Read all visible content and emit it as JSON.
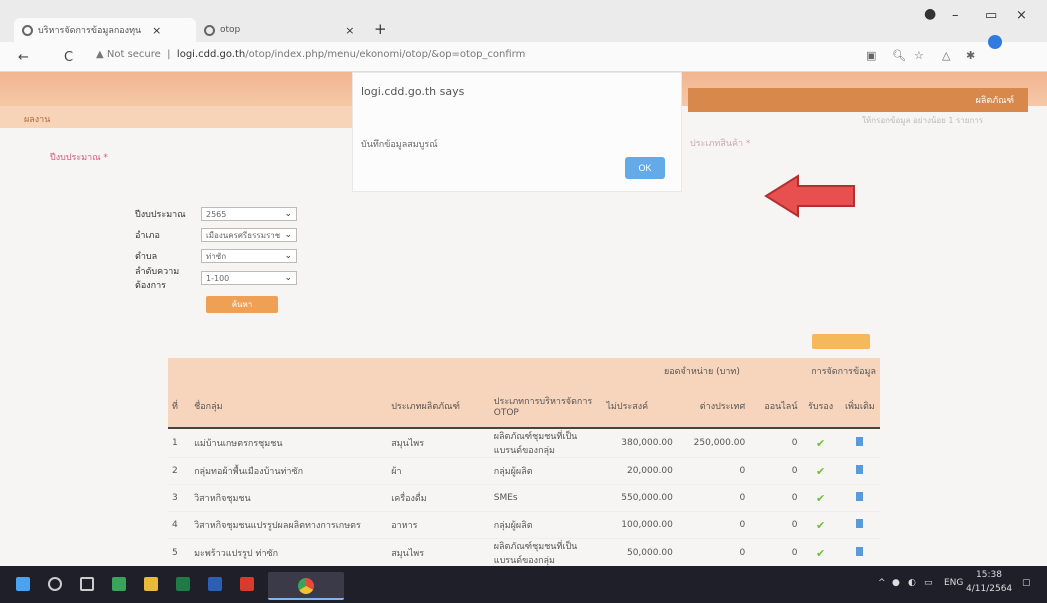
{
  "browser": {
    "tabs": [
      {
        "title": "บริหารจัดการข้อมูลกองทุน"
      },
      {
        "title": "otop"
      }
    ],
    "new_tab": "+",
    "url_prefix": "Not secure",
    "url_host": "logi.cdd.go.th",
    "url_path": "/otop/index.php/menu/ekonomi/otop/&op=otop_confirm",
    "window": {
      "minimize": "–",
      "maximize": "▭",
      "close": "×"
    }
  },
  "page": {
    "band_left": "ผลงาน",
    "band_right": "ผลิตภัณฑ์",
    "required_label": "ปีงบประมาณ *",
    "required_label_right": "ประเภทสินค้า *",
    "help_text": "ให้กรอกข้อมูล อย่างน้อย 1 รายการ"
  },
  "dialog": {
    "title": "logi.cdd.go.th says",
    "message": "บันทึกข้อมูลสมบูรณ์",
    "ok_label": "OK"
  },
  "filters": [
    {
      "label": "ปีงบประมาณ",
      "value": "2565"
    },
    {
      "label": "อำเภอ",
      "value": "เมืองนครศรีธรรมราช"
    },
    {
      "label": "ตำบล",
      "value": "ท่าซัก"
    },
    {
      "label": "ลำดับความต้องการ",
      "value": "1-100"
    }
  ],
  "search_label": "ค้นหา",
  "table": {
    "header_group_sales": "ยอดจำหน่าย (บาท)",
    "header_group_manage": "การจัดการข้อมูล",
    "columns": [
      "ที่",
      "ชื่อกลุ่ม",
      "ประเภทผลิตภัณฑ์",
      "ประเภทการบริหารจัดการ OTOP",
      "ไม่ประสงค์",
      "ต่างประเทศ",
      "ออนไลน์",
      "รับรอง",
      "เพิ่มเติม"
    ],
    "rows": [
      {
        "no": "1",
        "name": "แม่บ้านเกษตรกรชุมชน",
        "type": "สมุนไพร",
        "mgmt": "ผลิตภัณฑ์ชุมชนที่เป็นแบรนด์ของกลุ่ม",
        "sales": "380,000.00",
        "foreign": "250,000.00",
        "online": "0"
      },
      {
        "no": "2",
        "name": "กลุ่มทอผ้าพื้นเมืองบ้านท่าซัก",
        "type": "ผ้า",
        "mgmt": "กลุ่มผู้ผลิต",
        "sales": "20,000.00",
        "foreign": "0",
        "online": "0"
      },
      {
        "no": "3",
        "name": "วิสาหกิจชุมชน",
        "type": "เครื่องดื่ม",
        "mgmt": "SMEs",
        "sales": "550,000.00",
        "foreign": "0",
        "online": "0"
      },
      {
        "no": "4",
        "name": "วิสาหกิจชุมชนแปรรูปผลผลิตทางการเกษตร",
        "type": "อาหาร",
        "mgmt": "กลุ่มผู้ผลิต",
        "sales": "100,000.00",
        "foreign": "0",
        "online": "0"
      },
      {
        "no": "5",
        "name": "มะพร้าวแปรรูป ท่าซัก",
        "type": "สมุนไพร",
        "mgmt": "ผลิตภัณฑ์ชุมชนที่เป็นแบรนด์ของกลุ่ม",
        "sales": "50,000.00",
        "foreign": "0",
        "online": "0"
      }
    ]
  },
  "taskbar": {
    "lang": "ENG",
    "time": "15:38",
    "date": "4/11/2564"
  },
  "colors": {
    "accent_orange": "#f0a055",
    "band": "#f2b590",
    "ok_button": "#64a9e8",
    "arrow": "#e85050"
  }
}
